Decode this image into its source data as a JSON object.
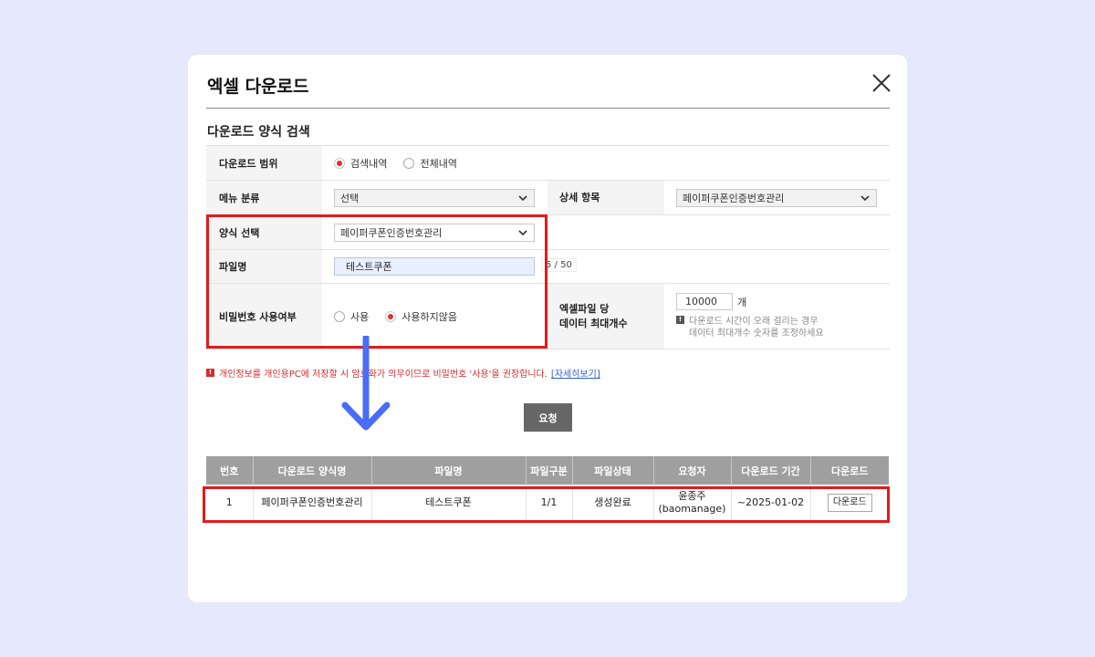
{
  "modal": {
    "title": "엑셀 다운로드",
    "section_title": "다운로드 양식 검색"
  },
  "form": {
    "scope": {
      "label": "다운로드 범위",
      "options": [
        "검색내역",
        "전체내역"
      ],
      "selected": "검색내역"
    },
    "menu": {
      "label": "메뉴 분류",
      "value": "선택",
      "detail_label": "상세 항목",
      "detail_value": "페이퍼쿠폰인증번호관리"
    },
    "template": {
      "label": "양식 선택",
      "value": "페이퍼쿠폰인증번호관리"
    },
    "filename": {
      "label": "파일명",
      "value": "테스트쿠폰",
      "counter": "5 / 50"
    },
    "password": {
      "label": "비밀번호 사용여부",
      "options": [
        "사용",
        "사용하지않음"
      ],
      "selected": "사용하지않음"
    },
    "max_rows": {
      "label_line1": "엑셀파일 당",
      "label_line2": "데이터 최대개수",
      "value": "10000",
      "unit": "개",
      "hint_line1": "다운로드 시간이 오래 걸리는 경우",
      "hint_line2": "데이터 최대개수 숫자를 조정하세요"
    }
  },
  "warning": {
    "text": "개인정보를 개인용PC에 저장할 시 암호화가 의무이므로 비밀번호 '사용'을 권장합니다.",
    "link": "[자세히보기]"
  },
  "request_button": "요청",
  "table": {
    "headers": [
      "번호",
      "다운로드 양식명",
      "파일명",
      "파일구분",
      "파일상태",
      "요청자",
      "다운로드 기간",
      "다운로드"
    ],
    "rows": [
      {
        "no": "1",
        "template": "페이퍼쿠폰인증번호관리",
        "filename": "테스트쿠폰",
        "part": "1/1",
        "status": "생성완료",
        "requester_name": "윤종주",
        "requester_id": "(baomanage)",
        "period": "~2025-01-02",
        "download": "다운로드"
      }
    ]
  },
  "colors": {
    "highlight": "#e31b1b",
    "arrow": "#4a6cf7",
    "header_bg": "#9f9f9f",
    "page_bg": "#e6e8fb"
  }
}
